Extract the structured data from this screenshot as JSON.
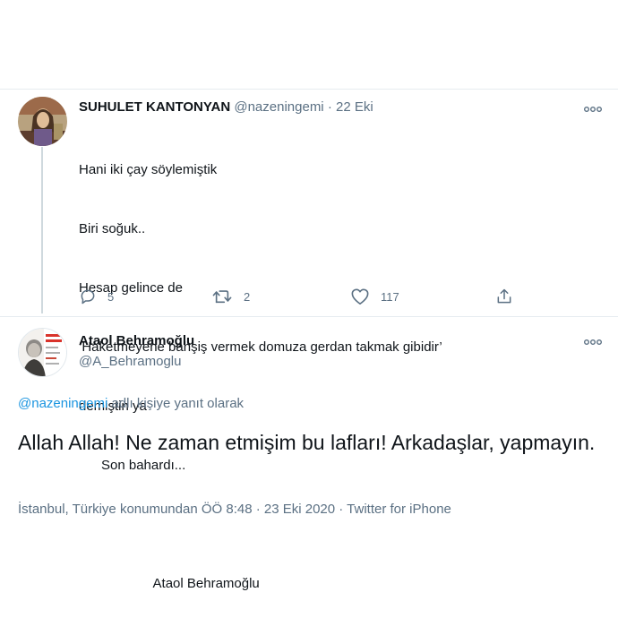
{
  "reply_tweet": {
    "display_name": "SUHULET KANTONYAN",
    "handle": "@nazeningemi",
    "separator": "·",
    "date": "22 Eki",
    "lines": [
      "Hani iki çay söylemiştik",
      "Biri soğuk..",
      "Hesap gelince de",
      "‘Haketmeyene bahşiş vermek domuza gerdan takmak gibidir’",
      "demiştin ya",
      "      Son bahardı...",
      "",
      "                    Ataol Behramoğlu"
    ],
    "actions": {
      "reply_count": "5",
      "retweet_count": "2",
      "like_count": "117"
    },
    "icons": [
      "more-icon",
      "reply-icon",
      "retweet-icon",
      "like-icon",
      "share-icon"
    ]
  },
  "main_tweet": {
    "display_name": "Ataol Behramoğlu",
    "handle": "@A_Behramoglu",
    "replying_mention": "@nazeningemi",
    "replying_suffix": " adlı kişiye yanıt olarak",
    "text": "Allah Allah! Ne zaman etmişim bu lafları! Arkadaşlar, yapmayın.",
    "meta": "İstanbul, Türkiye konumundan ÖÖ 8:48 · 23 Eki 2020 · Twitter for iPhone"
  },
  "colors": {
    "text_primary": "#0f1419",
    "text_secondary": "#5b7083",
    "link": "#1b95e0",
    "divider": "#e6ecf0",
    "thread_line": "#cfd9de"
  }
}
